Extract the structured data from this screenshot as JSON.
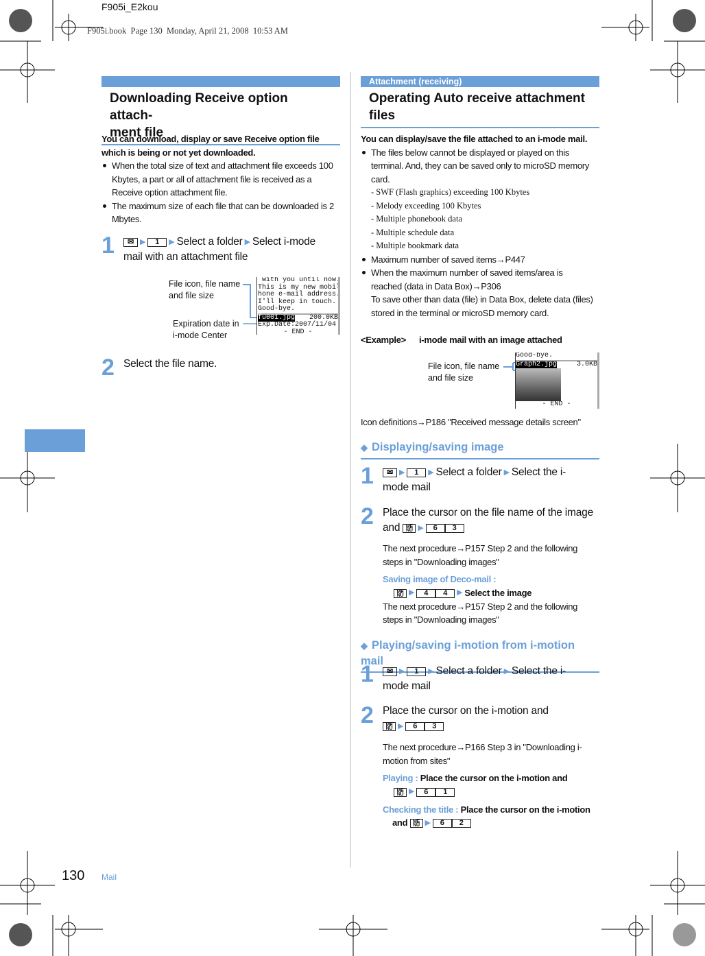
{
  "print_header": {
    "job": "F905i_E2kou",
    "info": "F905i.book  Page 130  Monday, April 21, 2008  10:53 AM"
  },
  "left": {
    "title_line1": "Downloading Receive option attach-",
    "title_line2": "ment file",
    "intro": [
      "You can download, display or save Receive option file",
      "which is being or not yet downloaded."
    ],
    "bullets": [
      [
        "When the total size of text and attachment file exceeds 100",
        "Kbytes, a part or all of attachment file is received as a",
        "Receive option attachment file."
      ],
      [
        "The maximum size of each file that can be downloaded is 2",
        "Mbytes."
      ]
    ],
    "step1": {
      "num": "1",
      "key": "1",
      "t1": "Select a folder",
      "t2": "Select i-mode",
      "t3": "mail with an attachment file"
    },
    "callout1": [
      "File icon, file name",
      "and file size"
    ],
    "callout2": [
      "Expiration date in",
      "i-mode Center"
    ],
    "screen": [
      " with you until now.",
      "This is my new mobile p",
      "hone e-mail address.",
      "I'll keep in touch.",
      "Good-bye."
    ],
    "screen_file": "fu001.jpg",
    "screen_size": "200.0KB",
    "screen_exp": "Exp.Date:2007/11/04",
    "screen_end": "- END -",
    "step2": {
      "num": "2",
      "text": "Select the file name."
    }
  },
  "right": {
    "category": "Attachment (receiving)",
    "title_line1": "Operating Auto receive attachment",
    "title_line2": "files",
    "intro": "You can display/save the file attached to an i-mode mail.",
    "bullet1": [
      "The files below cannot be displayed or played on this",
      "terminal. And, they can be saved only to microSD memory",
      "card."
    ],
    "dashes": [
      "- SWF (Flash graphics) exceeding 100 Kbytes",
      "- Melody exceeding 100 Kbytes",
      "- Multiple phonebook data",
      "- Multiple schedule data",
      "- Multiple bookmark data"
    ],
    "bullet2": "Maximum number of saved items→P447",
    "bullet3": [
      "When the maximum number of saved items/area is",
      "reached (data in Data Box)→P306",
      "To save other than data (file) in Data Box, delete data (files)",
      "stored in the terminal or microSD memory card."
    ],
    "example_label": "<Example>",
    "example_title": "i-mode mail with an image attached",
    "callout": [
      "File icon, file name",
      "and file size"
    ],
    "screen_top": "Good-bye.",
    "screen_file": "Graph2.jpg",
    "screen_size": "3.0KB",
    "screen_end": "- END -",
    "icon_def": "Icon definitions→P186 \"Received message details screen\"",
    "sec1": {
      "title": "Displaying/saving image",
      "s1": {
        "num": "1",
        "key": "1",
        "t1": "Select a folder",
        "t2": "Select the i-",
        "t3": "mode mail"
      },
      "s2": {
        "num": "2",
        "t1": "Place the cursor on the file name of the image",
        "t2": "and",
        "keys": [
          "6",
          "3"
        ]
      },
      "note": [
        "The next procedure→P157 Step 2 and the following",
        "steps in \"Downloading images\""
      ],
      "deco_label": "Saving image of Deco-mail :",
      "deco_keys": [
        "4",
        "4"
      ],
      "deco_text": "Select the image",
      "note2": [
        "The next procedure→P157 Step 2 and the following",
        "steps in \"Downloading images\""
      ]
    },
    "sec2": {
      "title": "Playing/saving i-motion from i-motion mail",
      "s1": {
        "num": "1",
        "key": "1",
        "t1": "Select a folder",
        "t2": "Select the i-",
        "t3": "mode mail"
      },
      "s2": {
        "num": "2",
        "t1": "Place the cursor on the i-motion and",
        "keys": [
          "6",
          "3"
        ]
      },
      "note": [
        "The next procedure→P166 Step 3 in \"Downloading i-",
        "motion from sites\""
      ],
      "play_label": "Playing :",
      "play_text": "Place the cursor on the i-motion and",
      "play_keys": [
        "6",
        "1"
      ],
      "title_label": "Checking the title :",
      "title_text": "Place the cursor on the i-motion",
      "title_and": "and",
      "title_keys": [
        "6",
        "2"
      ]
    }
  },
  "footer": {
    "page": "130",
    "section": "Mail"
  },
  "icons": {
    "mail_key": "✉",
    "menu_key": "ME NU",
    "arrow": "▶",
    "diamond": "◆"
  },
  "colors": {
    "accent": "#6a9fd8"
  }
}
